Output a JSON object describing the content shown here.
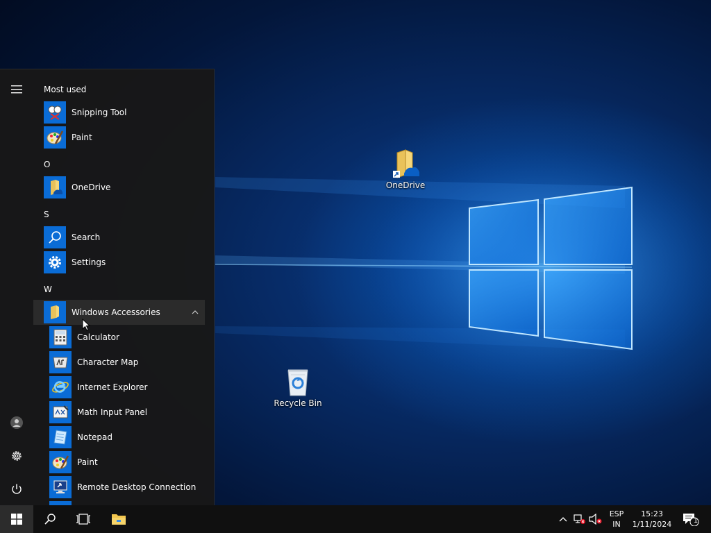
{
  "desktop": {
    "icons": [
      {
        "label": "OneDrive",
        "icon": "onedrive-shortcut-icon"
      },
      {
        "label": "Recycle Bin",
        "icon": "recycle-bin-icon"
      }
    ]
  },
  "start_menu": {
    "rail": [
      "hamburger-icon",
      "user-icon",
      "settings-icon",
      "power-icon"
    ],
    "groups": {
      "most_used": "Most used",
      "o": "O",
      "s": "S",
      "w": "W"
    },
    "apps": {
      "snipping_tool": "Snipping Tool",
      "paint": "Paint",
      "onedrive": "OneDrive",
      "search": "Search",
      "settings": "Settings",
      "windows_accessories": "Windows Accessories",
      "calculator": "Calculator",
      "character_map": "Character Map",
      "internet_explorer": "Internet Explorer",
      "math_input_panel": "Math Input Panel",
      "notepad": "Notepad",
      "paint2": "Paint",
      "remote_desktop": "Remote Desktop Connection"
    }
  },
  "taskbar": {
    "language_top": "ESP",
    "language_bottom": "IN",
    "time": "15:23",
    "date": "1/11/2024",
    "notification_count": "1"
  },
  "colors": {
    "accent": "#0a6cd6",
    "start_bg": "#181818",
    "taskbar_bg": "#101010"
  }
}
